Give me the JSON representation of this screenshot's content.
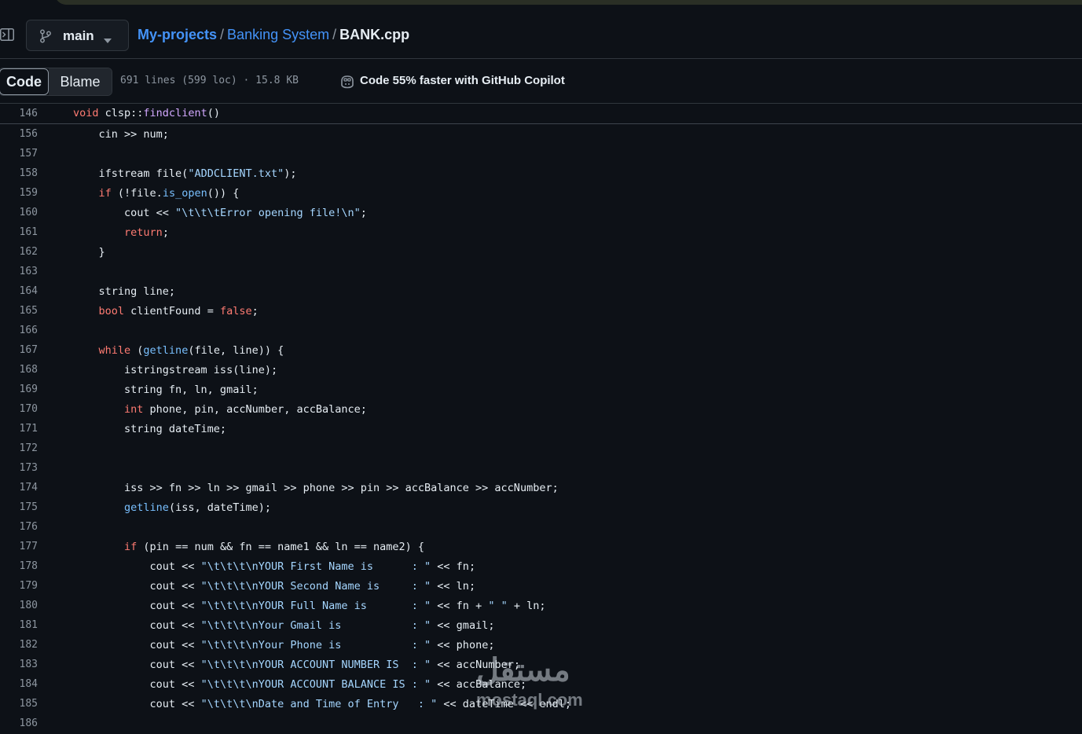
{
  "header": {
    "branch": "main",
    "breadcrumb": {
      "owner": "My-projects",
      "folder": "Banking System",
      "file": "BANK.cpp",
      "separator": "/"
    }
  },
  "toolbar": {
    "code_tab": "Code",
    "blame_tab": "Blame",
    "file_info": "691 lines (599 loc) · 15.8 KB",
    "copilot": "Code 55% faster with GitHub Copilot"
  },
  "sticky_line": {
    "number": "146",
    "code": "void clsp::findclient()"
  },
  "lines": [
    {
      "n": "156",
      "t": "    cin >> num;"
    },
    {
      "n": "157",
      "t": ""
    },
    {
      "n": "158",
      "t": "    ifstream file(\"ADDCLIENT.txt\");"
    },
    {
      "n": "159",
      "t": "    if (!file.is_open()) {"
    },
    {
      "n": "160",
      "t": "        cout << \"\\t\\t\\tError opening file!\\n\";"
    },
    {
      "n": "161",
      "t": "        return;"
    },
    {
      "n": "162",
      "t": "    }"
    },
    {
      "n": "163",
      "t": ""
    },
    {
      "n": "164",
      "t": "    string line;"
    },
    {
      "n": "165",
      "t": "    bool clientFound = false;"
    },
    {
      "n": "166",
      "t": ""
    },
    {
      "n": "167",
      "t": "    while (getline(file, line)) {"
    },
    {
      "n": "168",
      "t": "        istringstream iss(line);"
    },
    {
      "n": "169",
      "t": "        string fn, ln, gmail;"
    },
    {
      "n": "170",
      "t": "        int phone, pin, accNumber, accBalance;"
    },
    {
      "n": "171",
      "t": "        string dateTime;"
    },
    {
      "n": "172",
      "t": ""
    },
    {
      "n": "173",
      "t": ""
    },
    {
      "n": "174",
      "t": "        iss >> fn >> ln >> gmail >> phone >> pin >> accBalance >> accNumber;"
    },
    {
      "n": "175",
      "t": "        getline(iss, dateTime);"
    },
    {
      "n": "176",
      "t": ""
    },
    {
      "n": "177",
      "t": "        if (pin == num && fn == name1 && ln == name2) {"
    },
    {
      "n": "178",
      "t": "            cout << \"\\t\\t\\t\\nYOUR First Name is      : \" << fn;"
    },
    {
      "n": "179",
      "t": "            cout << \"\\t\\t\\t\\nYOUR Second Name is     : \" << ln;"
    },
    {
      "n": "180",
      "t": "            cout << \"\\t\\t\\t\\nYOUR Full Name is       : \" << fn + \" \" + ln;"
    },
    {
      "n": "181",
      "t": "            cout << \"\\t\\t\\t\\nYour Gmail is           : \" << gmail;"
    },
    {
      "n": "182",
      "t": "            cout << \"\\t\\t\\t\\nYour Phone is           : \" << phone;"
    },
    {
      "n": "183",
      "t": "            cout << \"\\t\\t\\t\\nYOUR ACCOUNT NUMBER IS  : \" << accNumber;"
    },
    {
      "n": "184",
      "t": "            cout << \"\\t\\t\\t\\nYOUR ACCOUNT BALANCE IS : \" << accBalance;"
    },
    {
      "n": "185",
      "t": "            cout << \"\\t\\t\\t\\nDate and Time of Entry   : \" << dateTime << endl;"
    },
    {
      "n": "186",
      "t": ""
    }
  ],
  "watermark": {
    "arabic": "مستقل",
    "latin": "mostaql.com"
  },
  "colors": {
    "keyword": "#ff7b72",
    "string": "#a5d6ff",
    "function": "#79c0ff",
    "link": "#4493f8",
    "background": "#0d1117"
  }
}
